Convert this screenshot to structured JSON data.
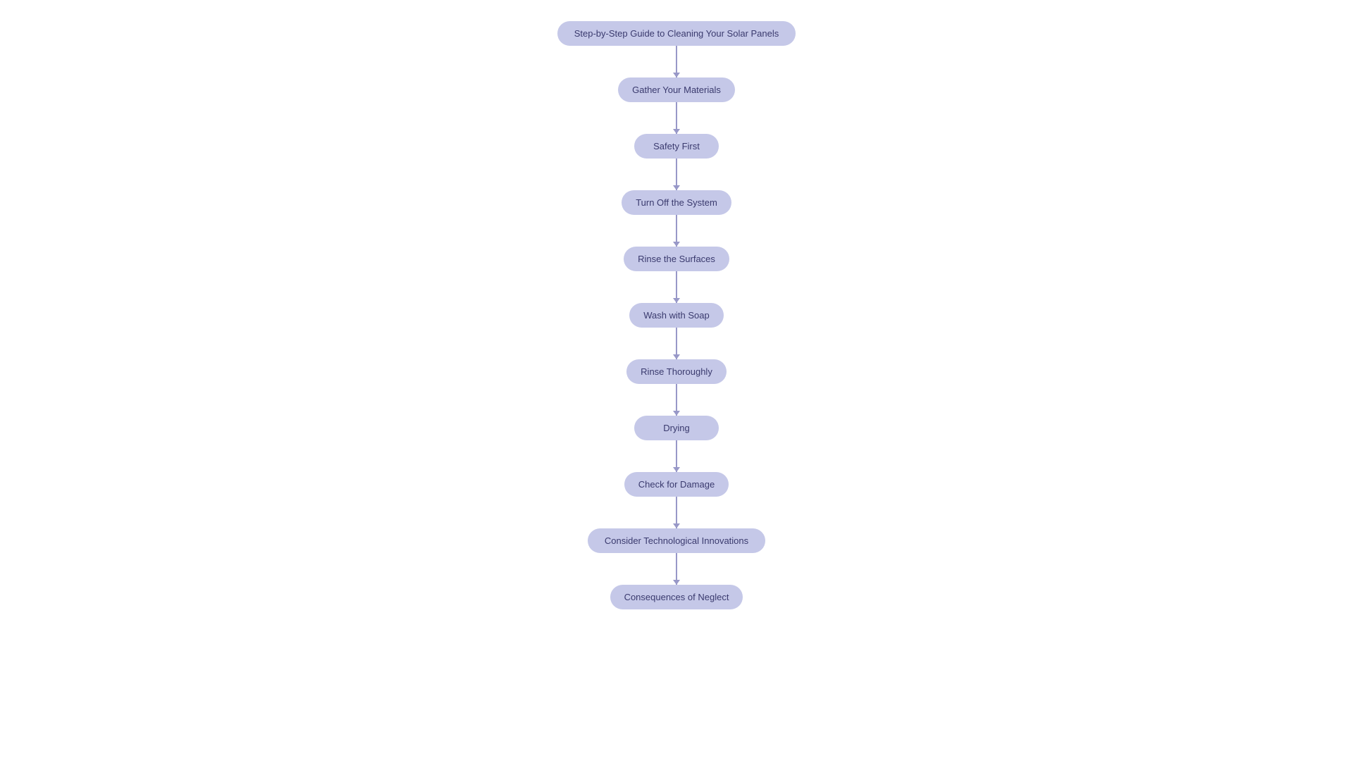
{
  "flowchart": {
    "nodes": [
      {
        "id": "title",
        "label": "Step-by-Step Guide to Cleaning Your Solar Panels",
        "type": "title"
      },
      {
        "id": "gather",
        "label": "Gather Your Materials",
        "type": "step"
      },
      {
        "id": "safety",
        "label": "Safety First",
        "type": "step"
      },
      {
        "id": "turn-off",
        "label": "Turn Off the System",
        "type": "step"
      },
      {
        "id": "rinse-surfaces",
        "label": "Rinse the Surfaces",
        "type": "step"
      },
      {
        "id": "wash-soap",
        "label": "Wash with Soap",
        "type": "step"
      },
      {
        "id": "rinse-thoroughly",
        "label": "Rinse Thoroughly",
        "type": "step"
      },
      {
        "id": "drying",
        "label": "Drying",
        "type": "step"
      },
      {
        "id": "check-damage",
        "label": "Check for Damage",
        "type": "step"
      },
      {
        "id": "consider-tech",
        "label": "Consider Technological Innovations",
        "type": "step"
      },
      {
        "id": "consequences",
        "label": "Consequences of Neglect",
        "type": "step"
      }
    ]
  }
}
